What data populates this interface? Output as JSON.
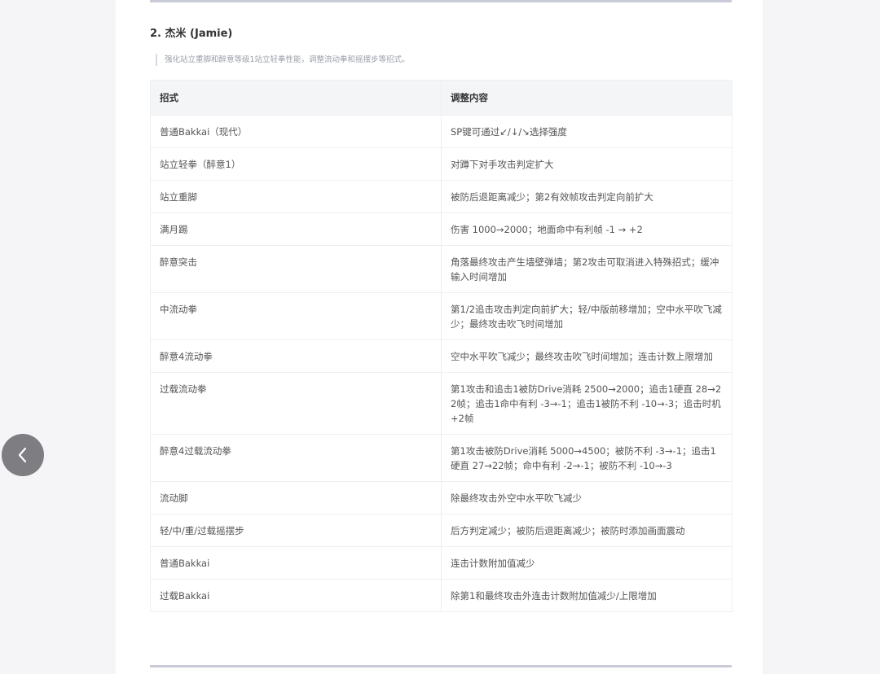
{
  "section": {
    "title": "2. 杰米 (Jamie)",
    "quote": "强化站立重脚和醉意等级1站立轻拳性能，调整流动拳和摇摆步等招式。"
  },
  "table": {
    "headers": [
      "招式",
      "调整内容"
    ],
    "rows": [
      {
        "move": "普通Bakkai（现代）",
        "change": "SP键可通过↙/↓/↘选择强度"
      },
      {
        "move": "站立轻拳（醉意1）",
        "change": "对蹲下对手攻击判定扩大"
      },
      {
        "move": "站立重脚",
        "change": "被防后退距离减少；第2有效帧攻击判定向前扩大"
      },
      {
        "move": "满月踢",
        "change": "伤害 1000→2000；地面命中有利帧 -1 → +2"
      },
      {
        "move": "醉意突击",
        "change": "角落最终攻击产生墙壁弹墙；第2攻击可取消进入特殊招式；缓冲输入时间增加"
      },
      {
        "move": "中流动拳",
        "change": "第1/2追击攻击判定向前扩大；轻/中版前移增加；空中水平吹飞减少；最终攻击吹飞时间增加"
      },
      {
        "move": "醉意4流动拳",
        "change": "空中水平吹飞减少；最终攻击吹飞时间增加；连击计数上限增加"
      },
      {
        "move": "过载流动拳",
        "change": "第1攻击和追击1被防Drive消耗 2500→2000；追击1硬直 28→22帧；追击1命中有利 -3→-1；追击1被防不利 -10→-3；追击时机+2帧"
      },
      {
        "move": "醉意4过载流动拳",
        "change": "第1攻击被防Drive消耗 5000→4500；被防不利 -3→-1；追击1硬直 27→22帧；命中有利 -2→-1；被防不利 -10→-3"
      },
      {
        "move": "流动脚",
        "change": "除最终攻击外空中水平吹飞减少"
      },
      {
        "move": "轻/中/重/过载摇摆步",
        "change": "后方判定减少；被防后退距离减少；被防时添加画面震动"
      },
      {
        "move": "普通Bakkai",
        "change": "连击计数附加值减少"
      },
      {
        "move": "过载Bakkai",
        "change": "除第1和最终攻击外连击计数附加值减少/上限增加"
      }
    ]
  },
  "nav": {
    "back_icon": "chevron-left-icon"
  }
}
